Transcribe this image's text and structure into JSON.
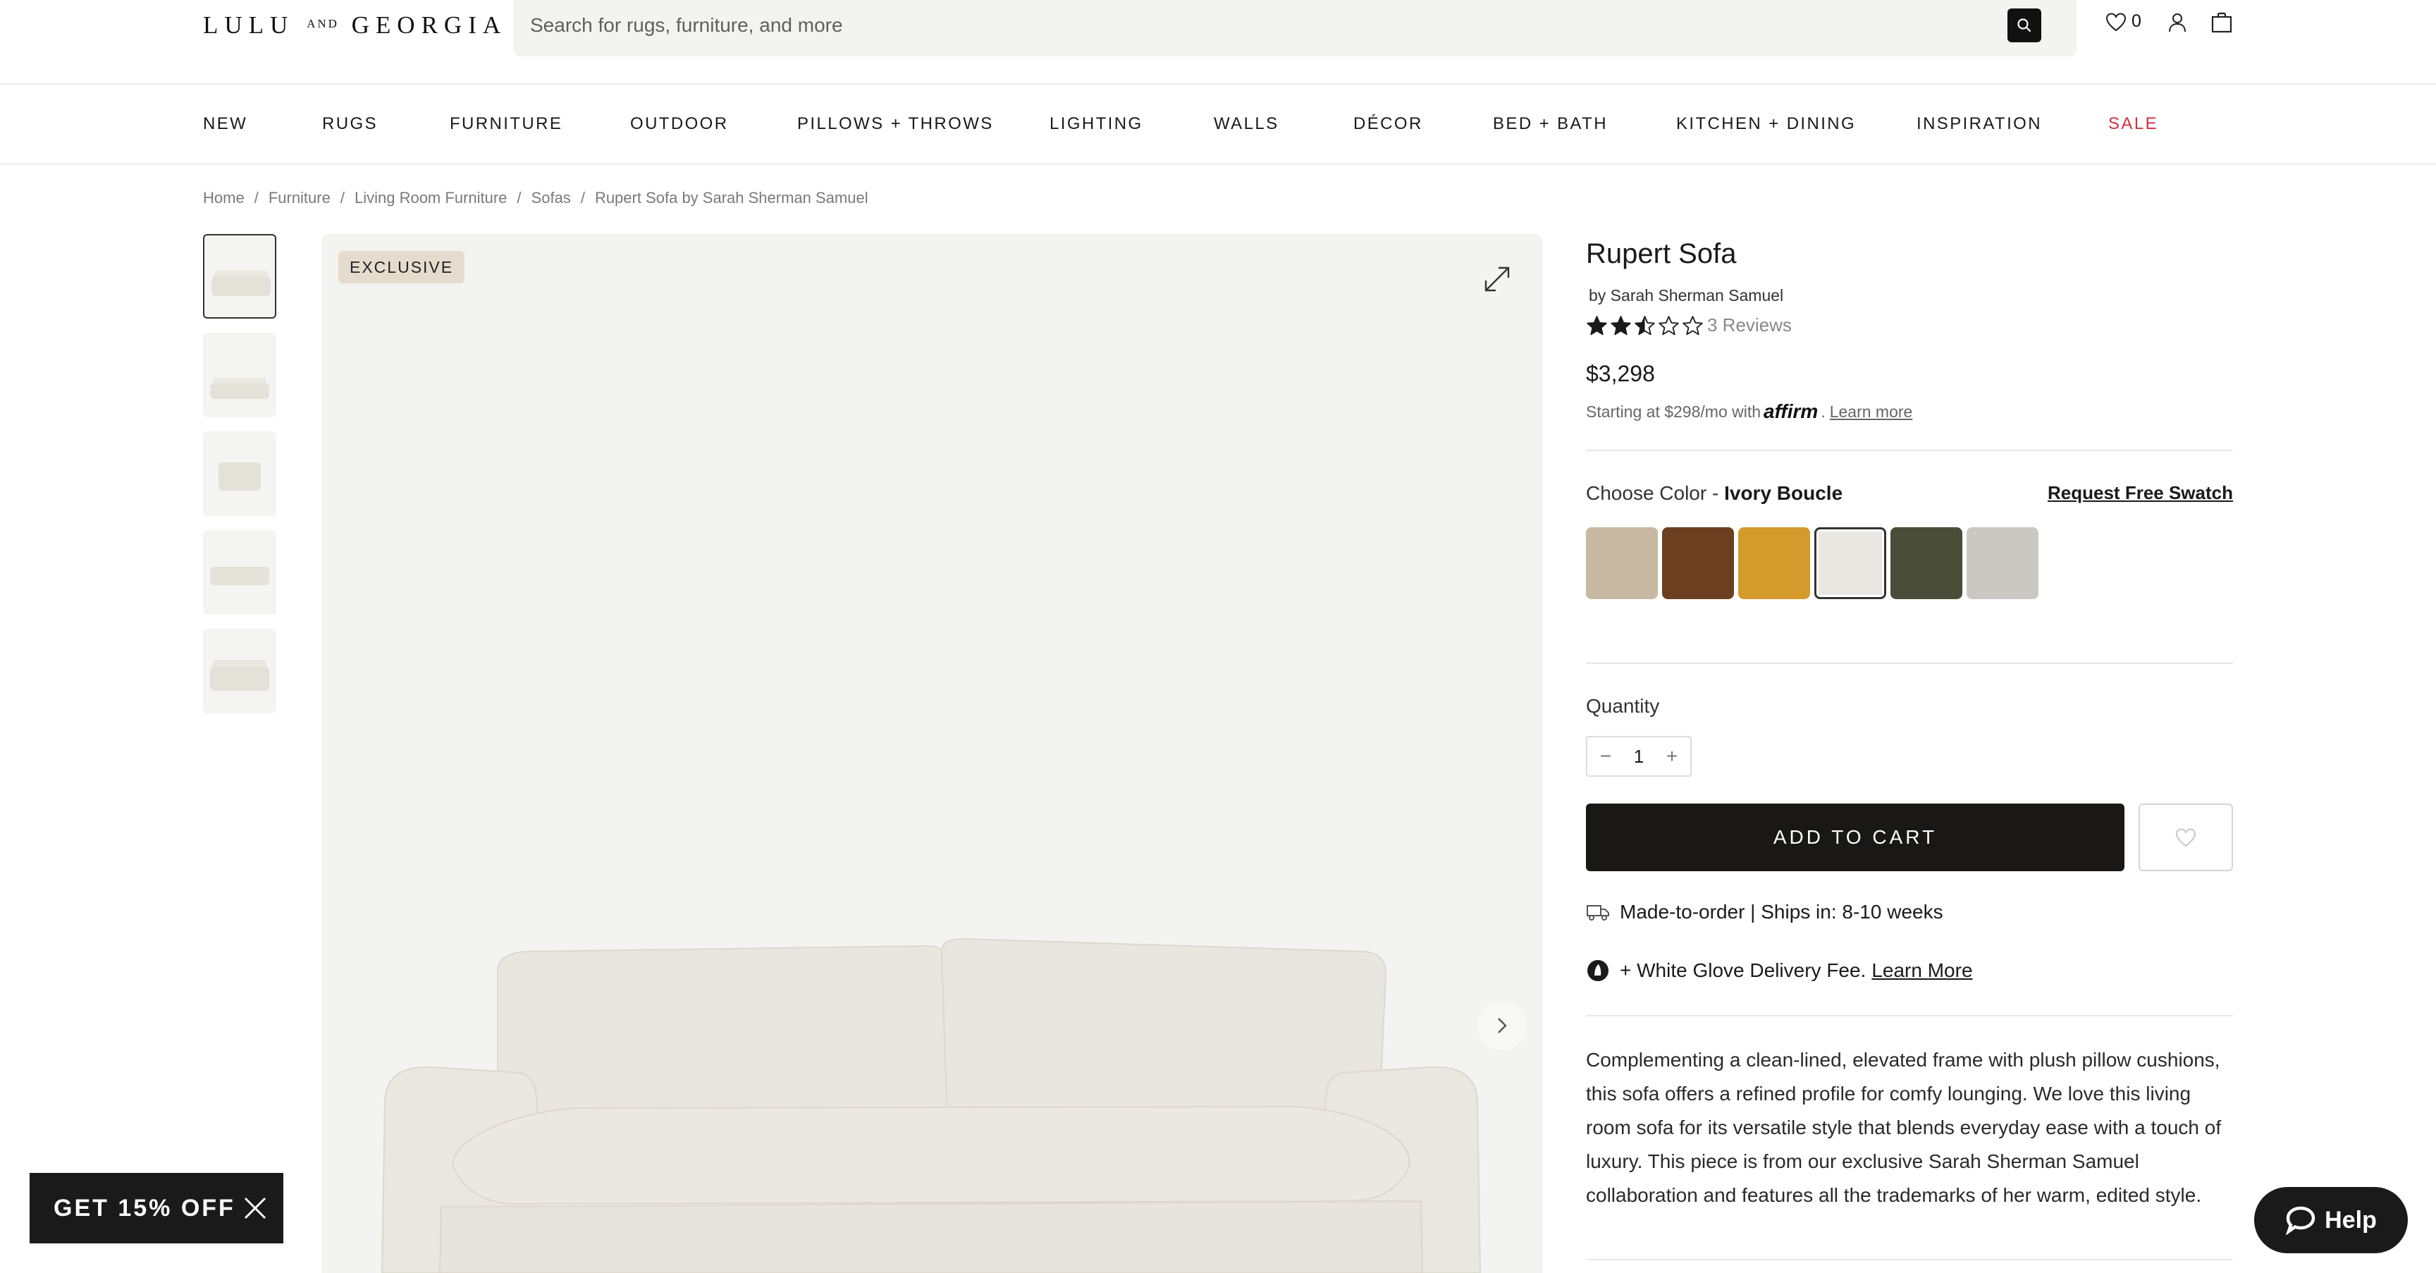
{
  "header": {
    "logo_left": "LULU",
    "logo_and": "AND",
    "logo_right": "GEORGIA",
    "search_placeholder": "Search for rugs, furniture, and more",
    "wishlist_count": "0"
  },
  "nav": {
    "items": [
      "NEW",
      "RUGS",
      "FURNITURE",
      "OUTDOOR",
      "PILLOWS + THROWS",
      "LIGHTING",
      "WALLS",
      "DÉCOR",
      "BED + BATH",
      "KITCHEN + DINING",
      "INSPIRATION",
      "SALE"
    ]
  },
  "breadcrumb": [
    "Home",
    "Furniture",
    "Living Room Furniture",
    "Sofas",
    "Rupert Sofa by Sarah Sherman Samuel"
  ],
  "gallery": {
    "badge": "EXCLUSIVE"
  },
  "product": {
    "title": "Rupert Sofa",
    "designer": "by Sarah Sherman Samuel",
    "rating": 2.5,
    "rating_max": 5,
    "reviews": "3 Reviews",
    "price": "$3,298",
    "financing_prefix": "Starting at $298/mo with",
    "financing_brand": "affirm",
    "financing_link": "Learn more",
    "color_prefix": "Choose Color -",
    "color_selected": "Ivory Boucle",
    "swatch_link": "Request Free Swatch",
    "swatch_colors": [
      "#c8b8a2",
      "#6b3f1f",
      "#d39a2c",
      "#e9e7e1",
      "#4a4d38",
      "#cbc8c4"
    ],
    "quantity_label": "Quantity",
    "quantity": "1",
    "qty_minus": "−",
    "qty_plus": "+",
    "add_to_cart": "ADD TO CART",
    "shipping": "Made-to-order | Ships in:  8-10 weeks",
    "white_glove": "+ White Glove Delivery Fee.",
    "white_glove_link": "Learn More",
    "description": "Complementing a clean-lined, elevated frame with plush pillow cushions, this sofa offers a refined profile for comfy lounging. We love this living room sofa for its versatile style that blends everyday ease with a touch of luxury. This piece is from our exclusive Sarah Sherman Samuel collaboration and features all the trademarks of her warm, edited style."
  },
  "promo": {
    "label": "GET 15% OFF"
  },
  "help": {
    "label": "Help"
  }
}
